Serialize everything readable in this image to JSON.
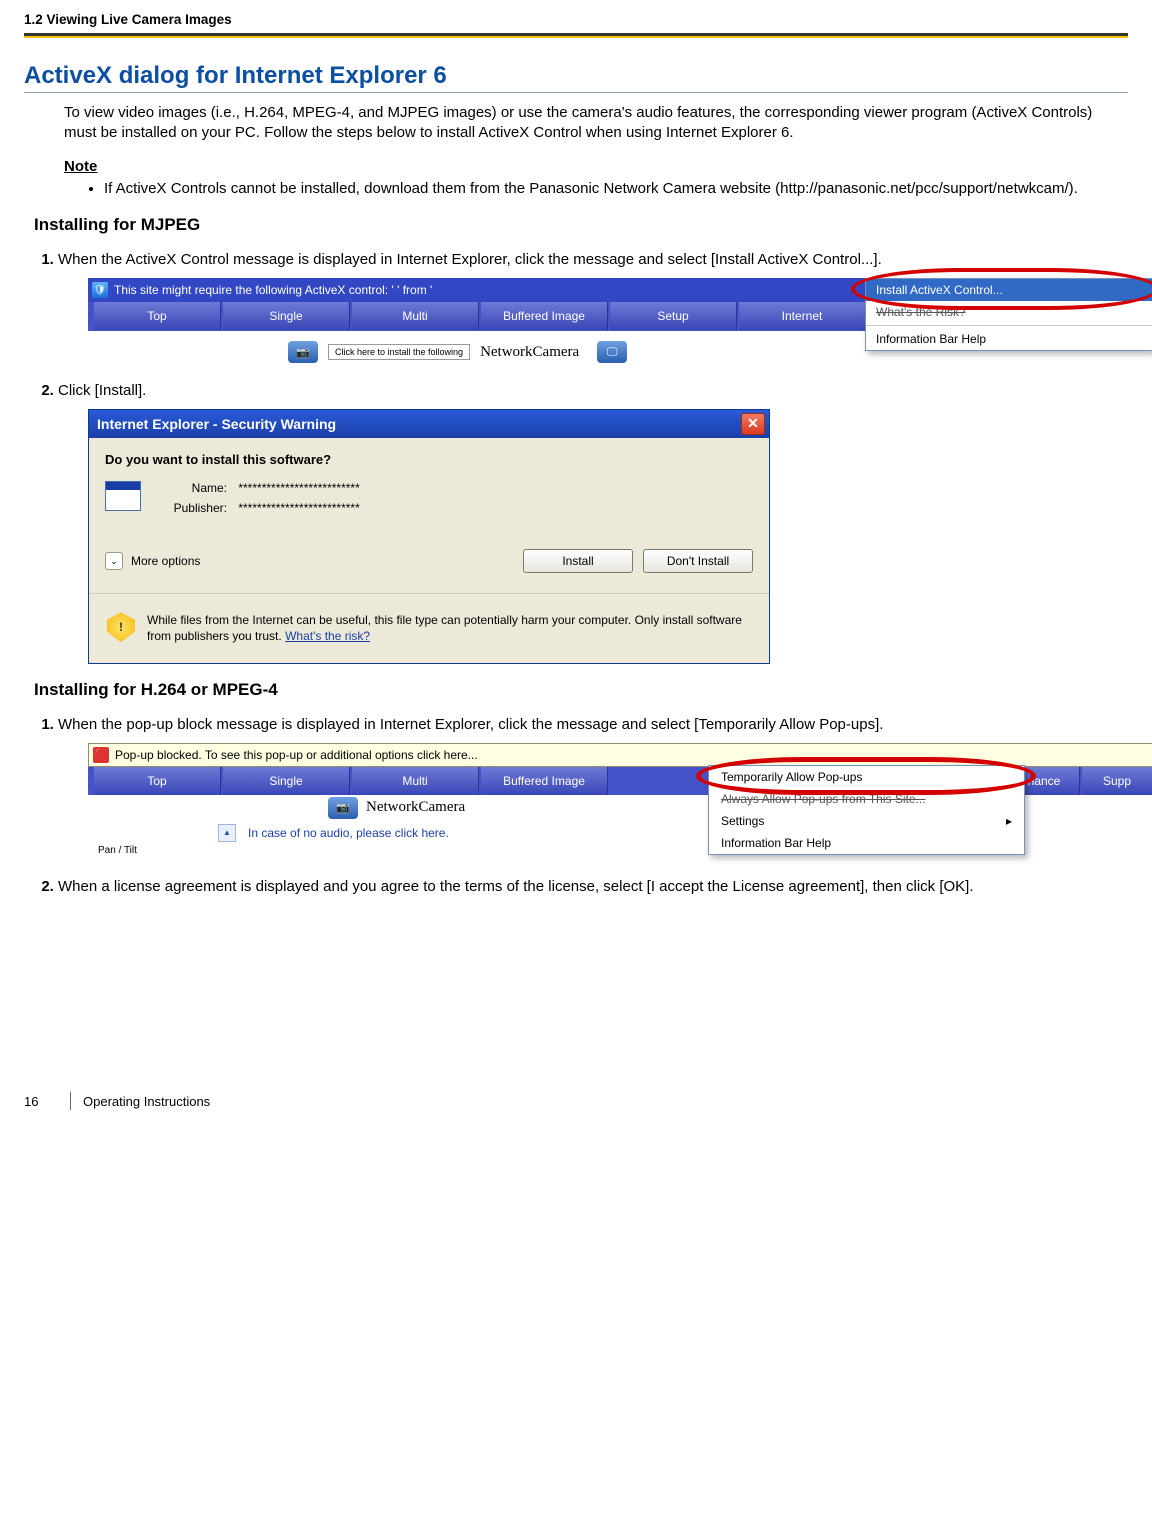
{
  "header": "1.2 Viewing Live Camera Images",
  "title": "ActiveX dialog for Internet Explorer 6",
  "intro": "To view video images (i.e., H.264, MPEG-4, and MJPEG images) or use the camera's audio features, the corresponding viewer program (ActiveX Controls) must be installed on your PC. Follow the steps below to install ActiveX Control when using Internet Explorer 6.",
  "note_label": "Note",
  "note_item": "If ActiveX Controls cannot be installed, download them from the Panasonic Network Camera website (http://panasonic.net/pcc/support/netwkcam/).",
  "sub_mjpeg": "Installing for MJPEG",
  "step_m1": "When the ActiveX Control message is displayed in Internet Explorer, click the message and select [Install ActiveX Control...].",
  "step_m2": "Click [Install].",
  "ie_infobar_text": "This site might require the following ActiveX control: '                                    ' from '",
  "tabs": [
    "Top",
    "Single",
    "Multi",
    "Buffered Image",
    "Setup",
    "Internet"
  ],
  "cam_tip": "Click here to install the following",
  "cam_name": "NetworkCamera",
  "ctx_install": "Install ActiveX Control...",
  "ctx_risk": "What's the Risk?",
  "ctx_help": "Information Bar Help",
  "dlg_title": "Internet Explorer - Security Warning",
  "dlg_q": "Do you want to install this software?",
  "dlg_name_lbl": "Name:",
  "dlg_name_val": "**************************",
  "dlg_pub_lbl": "Publisher:",
  "dlg_pub_val": "**************************",
  "dlg_more": "More options",
  "dlg_install": "Install",
  "dlg_dont": "Don't Install",
  "dlg_warn": "While files from the Internet can be useful, this file type can potentially harm your computer. Only install software from publishers you trust. ",
  "dlg_risk_link": "What's the risk?",
  "sub_h264": "Installing for H.264 or MPEG-4",
  "step_h1": "When the pop-up block message is displayed in Internet Explorer, click the message and select [Temporarily Allow Pop-ups].",
  "step_h2": "When a license agreement is displayed and you agree to the terms of the license, select [I accept the License agreement], then click [OK].",
  "popup_bar_text": "Pop-up blocked. To see this pop-up or additional options click here...",
  "tabs2_extra": [
    "nance",
    "Supp"
  ],
  "ctx2_temp": "Temporarily Allow Pop-ups",
  "ctx2_always": "Always Allow Pop-ups from This Site...",
  "ctx2_settings": "Settings",
  "ctx2_help": "Information Bar Help",
  "no_audio": "In case of no audio, please click here.",
  "pan_tilt": "Pan / Tilt",
  "page_num": "16",
  "doc_title": "Operating Instructions"
}
